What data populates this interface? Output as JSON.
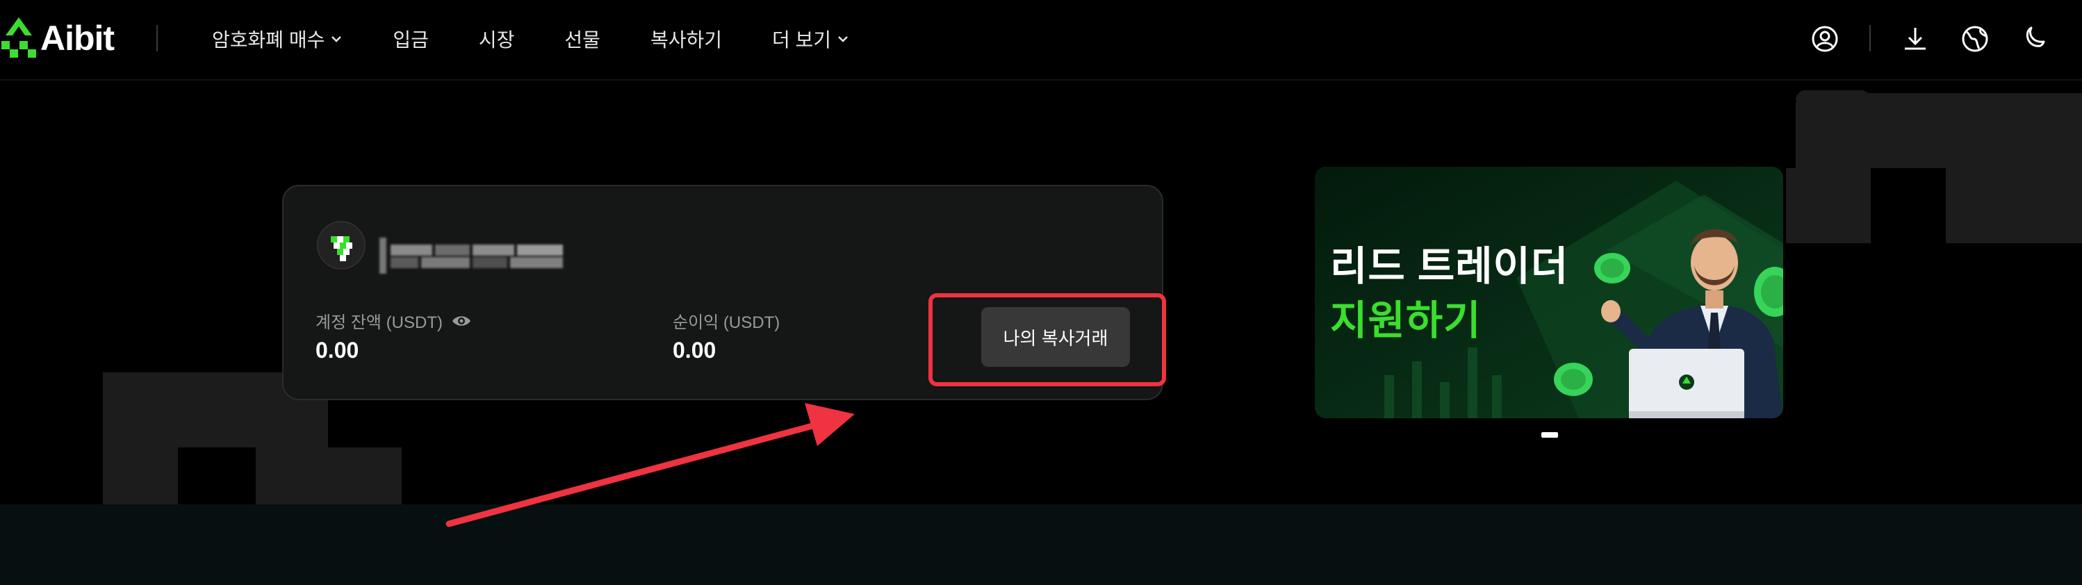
{
  "brand": {
    "name": "Aibit",
    "accent": "#3bde2e"
  },
  "nav": {
    "items": [
      {
        "label": "암호화폐 매수",
        "dropdown": true
      },
      {
        "label": "입금",
        "dropdown": false
      },
      {
        "label": "시장",
        "dropdown": false
      },
      {
        "label": "선물",
        "dropdown": false
      },
      {
        "label": "복사하기",
        "dropdown": false
      },
      {
        "label": "더 보기",
        "dropdown": true
      }
    ],
    "icons": [
      "user-icon",
      "download-icon",
      "globe-icon",
      "moon-icon"
    ]
  },
  "account": {
    "balance_label": "계정 잔액 (USDT)",
    "balance_value": "0.00",
    "profit_label": "순이익 (USDT)",
    "profit_value": "0.00",
    "copy_button": "나의 복사거래"
  },
  "banner": {
    "line1": "리드 트레이더",
    "line2": "지원하기"
  },
  "annotation": {
    "highlight_color": "#ef3340"
  }
}
